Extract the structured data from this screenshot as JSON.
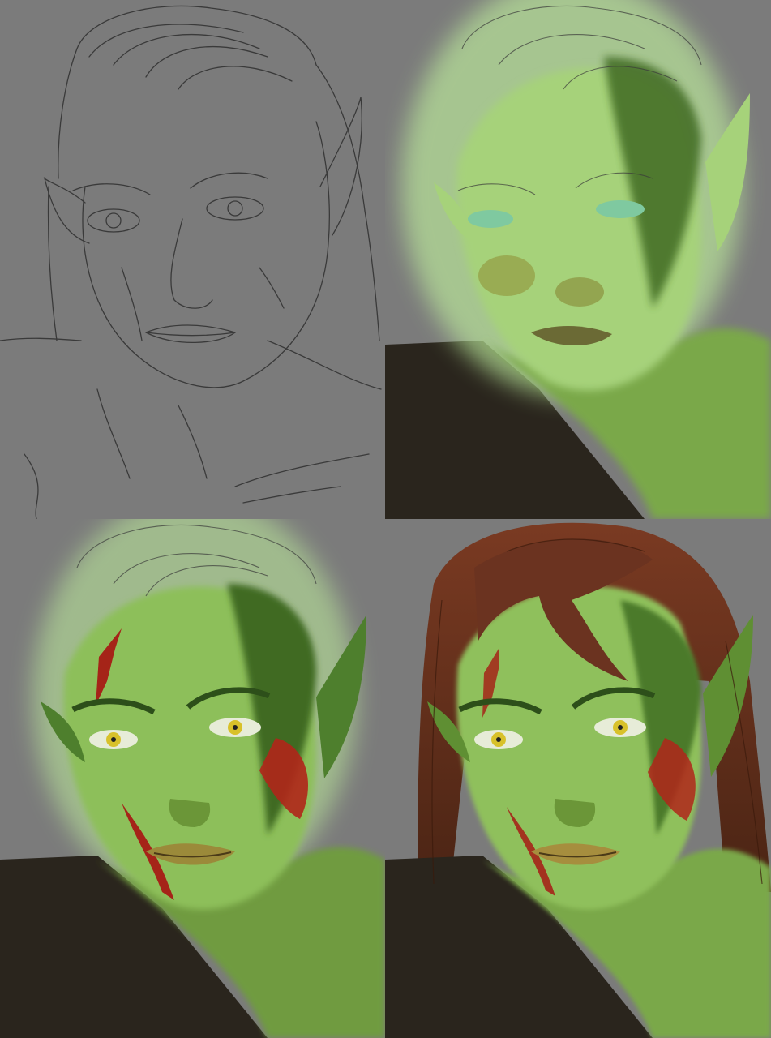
{
  "artwork": {
    "panels": [
      {
        "stage": "sketch"
      },
      {
        "stage": "flat-colors"
      },
      {
        "stage": "shading"
      },
      {
        "stage": "final"
      }
    ],
    "colors": {
      "canvas": "#7b7b7b",
      "line": "#3c3c3c",
      "skin_light": "#a6d27a",
      "skin_mid": "#7aa84a",
      "skin_dark": "#3f6a24",
      "glow": "#b9e59a",
      "clothing": "#2a251d",
      "blood": "#a52418",
      "hair": "#6b3320",
      "eye": "#d8c12a"
    }
  }
}
